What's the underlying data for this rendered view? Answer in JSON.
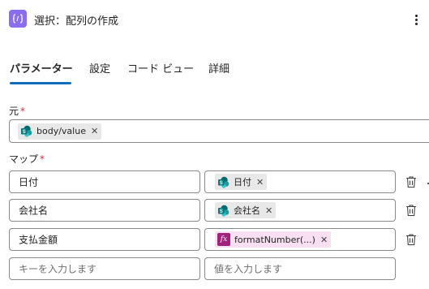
{
  "header": {
    "title": "選択：配列の作成",
    "icon": "variable-braces-icon",
    "icon_color": "#8a6df0"
  },
  "tabs": [
    {
      "label": "パラメーター",
      "active": true
    },
    {
      "label": "設定",
      "active": false
    },
    {
      "label": "コード ビュー",
      "active": false
    },
    {
      "label": "詳細",
      "active": false
    }
  ],
  "from": {
    "label": "元",
    "required_mark": "*",
    "token": {
      "label": "body/value",
      "icon": "sharepoint-icon"
    }
  },
  "map": {
    "label": "マップ",
    "required_mark": "*",
    "rows": [
      {
        "key": "日付",
        "value_token": {
          "label": "日付",
          "icon": "sharepoint-icon"
        }
      },
      {
        "key": "会社名",
        "value_token": {
          "label": "会社名",
          "icon": "sharepoint-icon"
        }
      },
      {
        "key": "支払金額",
        "value_token": {
          "label": "formatNumber(...)",
          "icon": "fx-icon",
          "icon_text": "fx"
        }
      }
    ],
    "new_row": {
      "key_placeholder": "キーを入力します",
      "value_placeholder": "値を入力します"
    }
  },
  "colors": {
    "accent": "#0f6cbd",
    "fx_token_bg": "#f8dff1",
    "fx_icon_bg": "#a0227a",
    "sp_token_bg": "#e8e8e8"
  }
}
